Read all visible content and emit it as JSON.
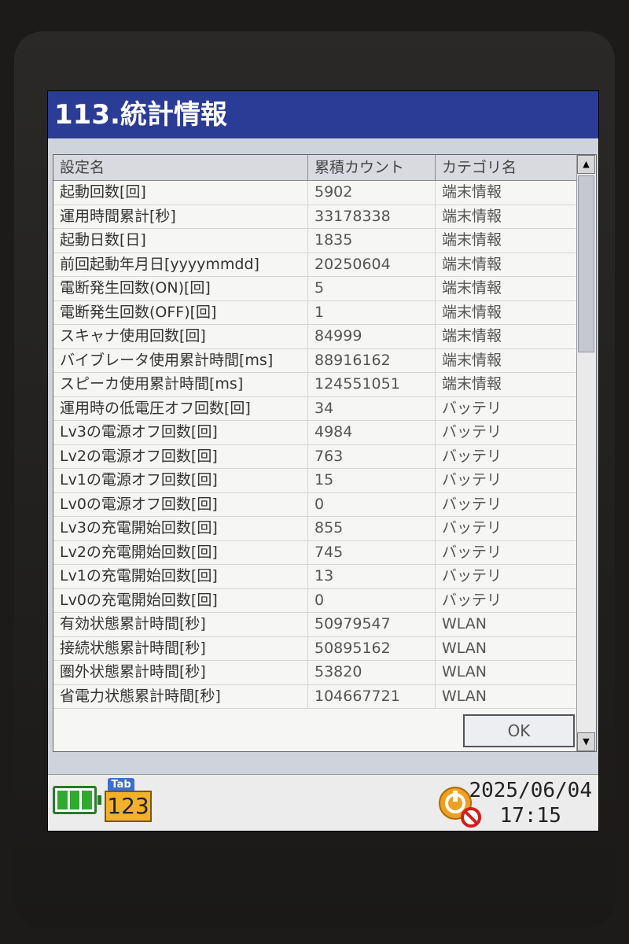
{
  "title": "113.統計情報",
  "table": {
    "headers": [
      "設定名",
      "累積カウント",
      "カテゴリ名"
    ],
    "rows": [
      [
        "起動回数[回]",
        "5902",
        "端末情報"
      ],
      [
        "運用時間累計[秒]",
        "33178338",
        "端末情報"
      ],
      [
        "起動日数[日]",
        "1835",
        "端末情報"
      ],
      [
        "前回起動年月日[yyyymmdd]",
        "20250604",
        "端末情報"
      ],
      [
        "電断発生回数(ON)[回]",
        "5",
        "端末情報"
      ],
      [
        "電断発生回数(OFF)[回]",
        "1",
        "端末情報"
      ],
      [
        "スキャナ使用回数[回]",
        "84999",
        "端末情報"
      ],
      [
        "バイブレータ使用累計時間[ms]",
        "88916162",
        "端末情報"
      ],
      [
        "スピーカ使用累計時間[ms]",
        "124551051",
        "端末情報"
      ],
      [
        "運用時の低電圧オフ回数[回]",
        "34",
        "バッテリ"
      ],
      [
        "Lv3の電源オフ回数[回]",
        "4984",
        "バッテリ"
      ],
      [
        "Lv2の電源オフ回数[回]",
        "763",
        "バッテリ"
      ],
      [
        "Lv1の電源オフ回数[回]",
        "15",
        "バッテリ"
      ],
      [
        "Lv0の電源オフ回数[回]",
        "0",
        "バッテリ"
      ],
      [
        "Lv3の充電開始回数[回]",
        "855",
        "バッテリ"
      ],
      [
        "Lv2の充電開始回数[回]",
        "745",
        "バッテリ"
      ],
      [
        "Lv1の充電開始回数[回]",
        "13",
        "バッテリ"
      ],
      [
        "Lv0の充電開始回数[回]",
        "0",
        "バッテリ"
      ],
      [
        "有効状態累計時間[秒]",
        "50979547",
        "WLAN"
      ],
      [
        "接続状態累計時間[秒]",
        "50895162",
        "WLAN"
      ],
      [
        "圏外状態累計時間[秒]",
        "53820",
        "WLAN"
      ],
      [
        "省電力状態累計時間[秒]",
        "104667721",
        "WLAN"
      ]
    ]
  },
  "ok_label": "OK",
  "taskbar": {
    "tab_label": "Tab",
    "input_mode": "123",
    "date": "2025/06/04",
    "time": "17:15",
    "battery_icon": "battery-full-icon",
    "power_icon": "power-disabled-icon"
  },
  "colors": {
    "title_bar": "#2b3c96",
    "screen_bg": "#cfd3db",
    "battery": "#2faa2f",
    "input_mode_bg": "#f2b12c"
  }
}
